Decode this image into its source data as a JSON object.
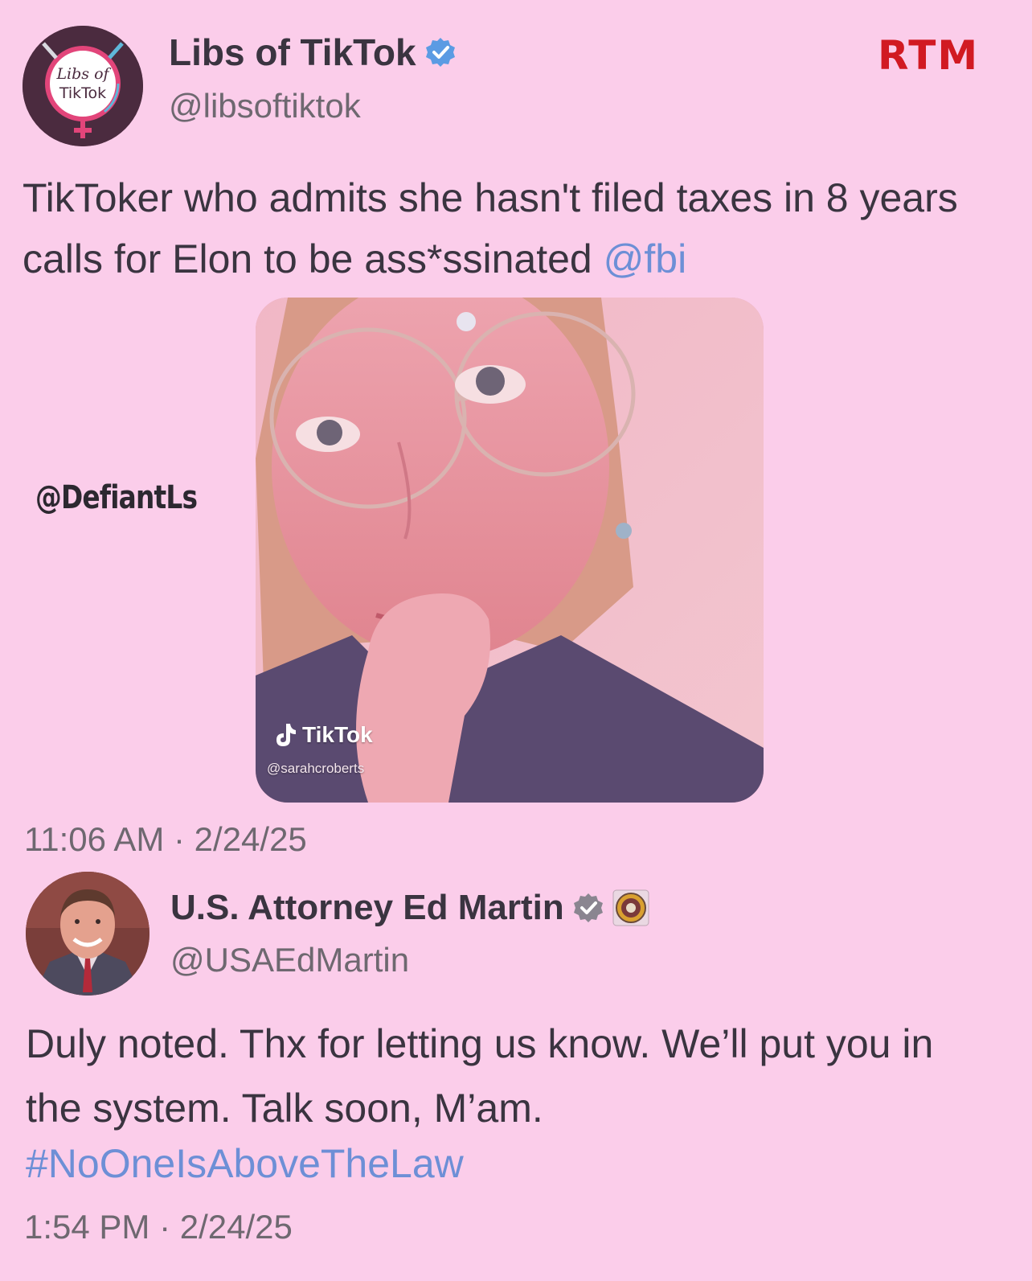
{
  "colors": {
    "background": "#fbcdea",
    "text": "#3a3440",
    "muted": "#6e6870",
    "link": "#6d8fd6",
    "brand_red": "#d11a22",
    "verified_blue": "#5b9be3",
    "verified_grey": "#8a8590"
  },
  "brand": {
    "logo_text": "RTM"
  },
  "watermark": {
    "text": "@DefiantLs"
  },
  "tweet1": {
    "display_name": "Libs of TikTok",
    "handle": "@libsoftiktok",
    "avatar_text": [
      "Libs of",
      "TikTok"
    ],
    "verified_icon": "blue-check-badge-icon",
    "text": "TikToker who admits she hasn't filed taxes in 8 years calls for Elon to be ass*ssinated ",
    "mention": "@fbi",
    "media": {
      "brand_label": "TikTok",
      "creator_handle": "@sarahcroberts"
    },
    "timestamp": "11:06 AM · 2/24/25"
  },
  "tweet2": {
    "display_name": "U.S. Attorney Ed Martin",
    "handle": "@USAEdMartin",
    "verified_icon": "grey-check-badge-icon",
    "affiliation_icon": "doj-seal-icon",
    "text": "Duly noted. Thx for letting us know. We’ll put you in the system. Talk soon, M’am.",
    "hashtag": "#NoOneIsAboveTheLaw",
    "timestamp": "1:54 PM · 2/24/25"
  }
}
